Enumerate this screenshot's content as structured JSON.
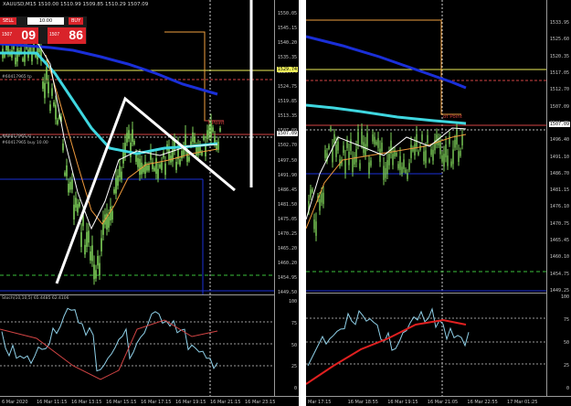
{
  "left": {
    "symbol": "XAUUSD,M15",
    "ohlc": "1510.00 1510.99 1509.85 1510.29 1507.09",
    "trade": {
      "sell_label": "SELL",
      "buy_label": "BUY",
      "lot": "10.00",
      "sell_small": "1507",
      "sell_big": "09",
      "buy_small": "1507",
      "buy_big": "86"
    },
    "prices": [
      "1550.05",
      "1545.15",
      "1540.20",
      "1535.35",
      "1529.74",
      "1524.75",
      "1519.85",
      "1513.35",
      "1507.09",
      "1502.70",
      "1497.50",
      "1491.90",
      "1486.45",
      "1481.50",
      "1475.05",
      "1470.25",
      "1465.20",
      "1460.20",
      "1454.95",
      "1449.50"
    ],
    "osc_prices": [
      "100",
      "75",
      "50",
      "25",
      "0"
    ],
    "times": [
      "6 Mar 2020",
      "16 Mar 11:15",
      "16 Mar 13:15",
      "16 Mar 15:15",
      "16 Mar 17:15",
      "16 Mar 19:15",
      "16 Mar 21:15",
      "16 Mar 23:15"
    ],
    "pivot_text": "t Point",
    "ind_labels": [
      "#60417965 tp",
      "#60417965 sl",
      "#60417965 buy 10.00"
    ],
    "osc_label": "Stoch(10,10,5) 65.4485 62.4106"
  },
  "right": {
    "prices": [
      "1533.95",
      "1525.60",
      "1520.35",
      "1517.05",
      "1512.70",
      "1507.09",
      "1501.75",
      "1496.40",
      "1491.10",
      "1486.70",
      "1481.15",
      "1476.10",
      "1470.75",
      "1465.45",
      "1460.10",
      "1454.75",
      "1449.25"
    ],
    "osc_prices": [
      "100",
      "75",
      "50",
      "25",
      "0"
    ],
    "times": [
      "Mar 17:15",
      "16 Mar 18:55",
      "16 Mar 19:15",
      "16 Mar 21:05",
      "16 Mar 22:55",
      "17 Mar 01:25"
    ],
    "pivot_text": "ot Point"
  },
  "colors": {
    "background": "#000000",
    "candle": "#7fd35a",
    "ema_fast": "#ffffff",
    "ema_mid": "#f09a3c",
    "ema_slow": "#3fd7e0",
    "ma_long": "#1a2fd8",
    "level_yellow": "#f0f05a",
    "level_orange": "#f0a040",
    "level_red": "#d24444",
    "level_green": "#3bbf3b",
    "sell_buy": "#d9232a"
  }
}
